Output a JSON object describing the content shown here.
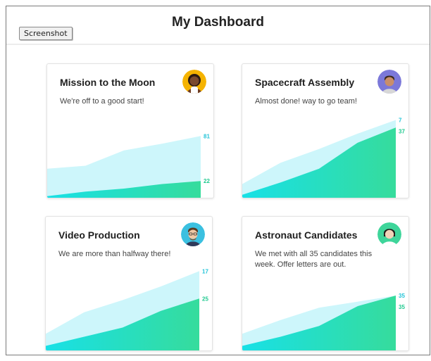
{
  "header": {
    "title": "My Dashboard",
    "screenshot_label": "Screenshot"
  },
  "colors": {
    "light_series": "#cdf6fb",
    "dark_gradient_start": "#18e0e6",
    "dark_gradient_end": "#36dc9c",
    "top_label": "#22c4d8",
    "bottom_label": "#1fc98f"
  },
  "cards": [
    {
      "title": "Mission to the Moon",
      "description": "We're off to a good start!",
      "avatar": "avatar-woman-curly-hair-icon",
      "avatar_bg": "#f5b300",
      "chart_data": {
        "type": "area",
        "series": [
          {
            "values": [
              38,
              42,
              62,
              71,
              81
            ]
          },
          {
            "values": [
              2,
              8,
              12,
              18,
              22
            ]
          }
        ],
        "labels": [
          "81",
          "22"
        ]
      }
    },
    {
      "title": "Spacecraft Assembly",
      "description": "Almost done! way to go team!",
      "avatar": "avatar-man-short-hair-icon",
      "avatar_bg": "#7b78d9",
      "chart_data": {
        "type": "area",
        "series": [
          {
            "values": [
              18,
              46,
              64,
              84,
              102
            ]
          },
          {
            "values": [
              4,
              20,
              38,
              72,
              92
            ]
          }
        ],
        "labels": [
          "7",
          "37"
        ]
      }
    },
    {
      "title": "Video Production",
      "description": "We are more than halfway there!",
      "avatar": "avatar-man-glasses-icon",
      "avatar_bg": "#3bc0e0",
      "chart_data": {
        "type": "area",
        "series": [
          {
            "values": [
              22,
              50,
              66,
              84,
              104
            ]
          },
          {
            "values": [
              6,
              18,
              30,
              52,
              68
            ]
          }
        ],
        "labels": [
          "17",
          "25"
        ]
      }
    },
    {
      "title": "Astronaut Candidates",
      "description": "We met with all 35 candidates this week. Offer letters are out.",
      "avatar": "avatar-woman-dark-hair-icon",
      "avatar_bg": "#3ed59a",
      "chart_data": {
        "type": "area",
        "series": [
          {
            "values": [
              22,
              40,
              56,
              64,
              72
            ]
          },
          {
            "values": [
              6,
              18,
              32,
              58,
              72
            ]
          }
        ],
        "labels": [
          "35",
          "35"
        ]
      }
    }
  ]
}
